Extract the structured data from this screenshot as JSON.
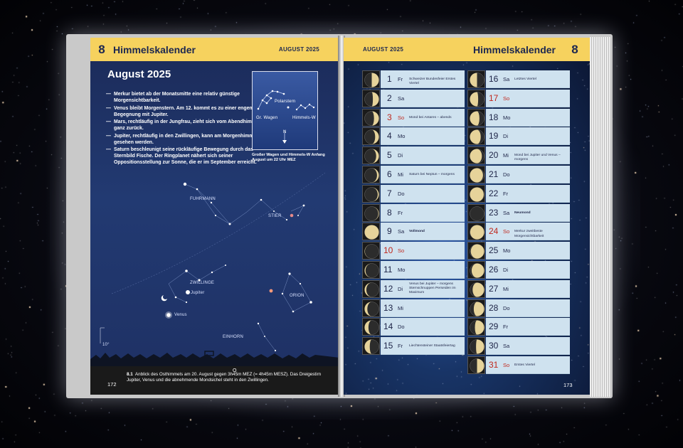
{
  "colors": {
    "header_yellow": "#f6d25e",
    "navy_text": "#1c2750",
    "sunday_red": "#c0281d",
    "calendar_cell": "#cfe2ef"
  },
  "left_page": {
    "chapter_number": "8",
    "chapter_title": "Himmelskalender",
    "month_label": "AUGUST 2025",
    "heading": "August 2025",
    "bullets": [
      "Merkur bietet ab der Monatsmitte eine relativ günstige Morgensichtbarkeit.",
      "Venus bleibt Morgenstern. Am 12. kommt es zu einer engen Begegnung mit Jupiter.",
      "Mars, rechtläufig in der Jungfrau, zieht sich vom Abendhimmel ganz zurück.",
      "Jupiter, rechtläufig in den Zwillingen, kann am Morgenhimmel gesehen werden.",
      "Saturn beschleunigt seine rückläufige Bewegung durch das Sternbild Fische. Der Ringplanet nähert sich seiner Oppositionsstellung zur Sonne, die er im September erreicht."
    ],
    "inset": {
      "labels": [
        "Polarstern",
        "Gr. Wagen",
        "Himmels-W",
        "N"
      ],
      "caption": "Großer Wagen und Himmels-W Anfang August um 22 Uhr MEZ"
    },
    "sky_labels": [
      "FUHRMANN",
      "STIER",
      "ZWILLINGE",
      "Jupiter",
      "Venus",
      "ORION",
      "EINHORN"
    ],
    "altitude_label": "10°",
    "compass": "O",
    "page_number": "172",
    "figure_caption": {
      "number": "8.1",
      "text": "Anblick des Osthimmels am 20. August gegen 3h45m MEZ (= 4h45m MESZ). Das Dreigestirn Jupiter, Venus und die abnehmende Mondsichel steht in den Zwillingen."
    }
  },
  "right_page": {
    "month_label": "AUGUST 2025",
    "chapter_title": "Himmelskalender",
    "chapter_number": "8",
    "page_number": "173",
    "days": [
      {
        "day": "1",
        "wd": "Fr",
        "note": "Schweizer Bundesfeier Erstes Viertel",
        "note_bold": false,
        "sunday": false,
        "phase": 0.5
      },
      {
        "day": "2",
        "wd": "Sa",
        "note": "",
        "note_bold": false,
        "sunday": false,
        "phase": 0.58
      },
      {
        "day": "3",
        "wd": "So",
        "note": "Mond bei Antares – abends",
        "note_bold": false,
        "sunday": true,
        "phase": 0.66
      },
      {
        "day": "4",
        "wd": "Mo",
        "note": "",
        "note_bold": false,
        "sunday": false,
        "phase": 0.74
      },
      {
        "day": "5",
        "wd": "Di",
        "note": "",
        "note_bold": false,
        "sunday": false,
        "phase": 0.81
      },
      {
        "day": "6",
        "wd": "Mi",
        "note": "Saturn bei Neptun – morgens",
        "note_bold": false,
        "sunday": false,
        "phase": 0.87
      },
      {
        "day": "7",
        "wd": "Do",
        "note": "",
        "note_bold": false,
        "sunday": false,
        "phase": 0.92
      },
      {
        "day": "8",
        "wd": "Fr",
        "note": "",
        "note_bold": false,
        "sunday": false,
        "phase": 0.96
      },
      {
        "day": "9",
        "wd": "Sa",
        "note": "Vollmond",
        "note_bold": true,
        "sunday": false,
        "phase": 1.0
      },
      {
        "day": "10",
        "wd": "So",
        "note": "",
        "note_bold": false,
        "sunday": true,
        "phase": 0.98
      },
      {
        "day": "11",
        "wd": "Mo",
        "note": "",
        "note_bold": false,
        "sunday": false,
        "phase": 0.94
      },
      {
        "day": "12",
        "wd": "Di",
        "note": "Venus bei Jupiter – morgens Sternschnuppen Perseiden im Maximum",
        "note_bold": false,
        "sunday": false,
        "phase": 0.88
      },
      {
        "day": "13",
        "wd": "Mi",
        "note": "",
        "note_bold": false,
        "sunday": false,
        "phase": 0.81
      },
      {
        "day": "14",
        "wd": "Do",
        "note": "",
        "note_bold": false,
        "sunday": false,
        "phase": 0.73
      },
      {
        "day": "15",
        "wd": "Fr",
        "note": "Liechtensteiner Staatsfeiertag",
        "note_bold": false,
        "sunday": false,
        "phase": 0.64
      },
      {
        "day": "16",
        "wd": "Sa",
        "note": "Letztes Viertel",
        "note_bold": false,
        "sunday": false,
        "phase": 0.5
      },
      {
        "day": "17",
        "wd": "So",
        "note": "",
        "note_bold": false,
        "sunday": true,
        "phase": 0.42
      },
      {
        "day": "18",
        "wd": "Mo",
        "note": "",
        "note_bold": false,
        "sunday": false,
        "phase": 0.33
      },
      {
        "day": "19",
        "wd": "Di",
        "note": "",
        "note_bold": false,
        "sunday": false,
        "phase": 0.24
      },
      {
        "day": "20",
        "wd": "Mi",
        "note": "Mond bei Jupiter und Venus – morgens",
        "note_bold": false,
        "sunday": false,
        "phase": 0.16
      },
      {
        "day": "21",
        "wd": "Do",
        "note": "",
        "note_bold": false,
        "sunday": false,
        "phase": 0.08
      },
      {
        "day": "22",
        "wd": "Fr",
        "note": "",
        "note_bold": false,
        "sunday": false,
        "phase": 0.03
      },
      {
        "day": "23",
        "wd": "Sa",
        "note": "Neumond",
        "note_bold": true,
        "sunday": false,
        "phase": 0.0
      },
      {
        "day": "24",
        "wd": "So",
        "note": "Merkur zweitbeste Morgensichtbarkeit",
        "note_bold": false,
        "sunday": true,
        "phase": 0.02
      },
      {
        "day": "25",
        "wd": "Mo",
        "note": "",
        "note_bold": false,
        "sunday": false,
        "phase": 0.06
      },
      {
        "day": "26",
        "wd": "Di",
        "note": "",
        "note_bold": false,
        "sunday": false,
        "phase": 0.12
      },
      {
        "day": "27",
        "wd": "Mi",
        "note": "",
        "note_bold": false,
        "sunday": false,
        "phase": 0.19
      },
      {
        "day": "28",
        "wd": "Do",
        "note": "",
        "note_bold": false,
        "sunday": false,
        "phase": 0.27
      },
      {
        "day": "29",
        "wd": "Fr",
        "note": "",
        "note_bold": false,
        "sunday": false,
        "phase": 0.35
      },
      {
        "day": "30",
        "wd": "Sa",
        "note": "",
        "note_bold": false,
        "sunday": false,
        "phase": 0.43
      },
      {
        "day": "31",
        "wd": "So",
        "note": "Erstes Viertel",
        "note_bold": false,
        "sunday": true,
        "phase": 0.5
      }
    ]
  }
}
